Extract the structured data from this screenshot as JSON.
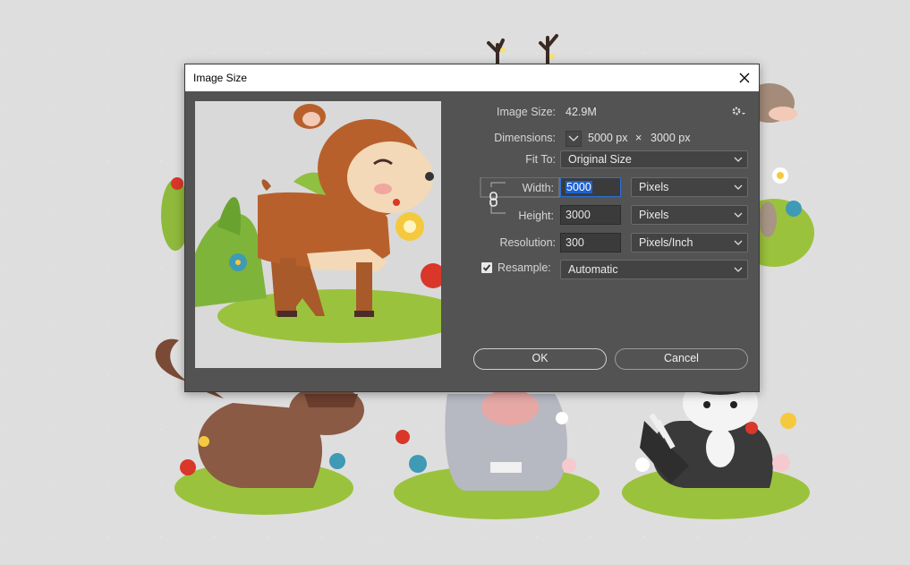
{
  "dialog": {
    "title": "Image Size",
    "image_size_label": "Image Size:",
    "image_size_value": "42.9M",
    "dimensions_label": "Dimensions:",
    "dimensions_width": "5000 px",
    "dimensions_times": "×",
    "dimensions_height": "3000 px",
    "fit_to_label": "Fit To:",
    "fit_to_value": "Original Size",
    "width_label": "Width:",
    "width_value": "5000",
    "width_unit": "Pixels",
    "height_label": "Height:",
    "height_value": "3000",
    "height_unit": "Pixels",
    "resolution_label": "Resolution:",
    "resolution_value": "300",
    "resolution_unit": "Pixels/Inch",
    "resample_label": "Resample:",
    "resample_checked": true,
    "resample_value": "Automatic",
    "ok_label": "OK",
    "cancel_label": "Cancel"
  },
  "colors": {
    "dialog_bg": "#535353",
    "field_bg": "#3b3b3b",
    "selection": "#1e62d0",
    "canvas_bg": "#dedede"
  },
  "icons": [
    "close-icon",
    "gear-icon",
    "chain-link-icon",
    "chevron-down-icon",
    "checkbox-check-icon"
  ]
}
